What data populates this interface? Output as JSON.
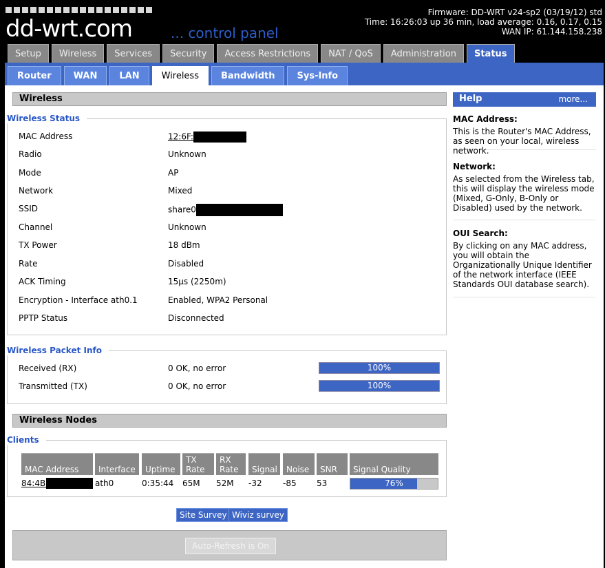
{
  "header": {
    "logo": "dd-wrt.com",
    "subtitle": "... control panel",
    "firmware": "Firmware: DD-WRT v24-sp2 (03/19/12) std",
    "time": "Time: 16:26:03 up 36 min, load average: 0.16, 0.17, 0.15",
    "wan_ip": "WAN IP: 61.144.158.238"
  },
  "main_tabs": [
    "Setup",
    "Wireless",
    "Services",
    "Security",
    "Access Restrictions",
    "NAT / QoS",
    "Administration",
    "Status"
  ],
  "sub_tabs": [
    "Router",
    "WAN",
    "LAN",
    "Wireless",
    "Bandwidth",
    "Sys-Info"
  ],
  "section_title": "Wireless",
  "wireless_status": {
    "legend": "Wireless Status",
    "rows": [
      {
        "label": "MAC Address",
        "value": "12:6F:"
      },
      {
        "label": "Radio",
        "value": "Unknown"
      },
      {
        "label": "Mode",
        "value": "AP"
      },
      {
        "label": "Network",
        "value": "Mixed"
      },
      {
        "label": "SSID",
        "value": "share0"
      },
      {
        "label": "Channel",
        "value": "Unknown"
      },
      {
        "label": "TX Power",
        "value": "18 dBm"
      },
      {
        "label": "Rate",
        "value": "Disabled"
      },
      {
        "label": "ACK Timing",
        "value": "15µs (2250m)"
      },
      {
        "label": "Encryption - Interface ath0.1",
        "value": "Enabled, WPA2 Personal"
      },
      {
        "label": "PPTP Status",
        "value": "Disconnected"
      }
    ]
  },
  "packet_info": {
    "legend": "Wireless Packet Info",
    "rows": [
      {
        "label": "Received (RX)",
        "value": "0 OK, no error",
        "bar": "100%"
      },
      {
        "label": "Transmitted (TX)",
        "value": "0 OK, no error",
        "bar": "100%"
      }
    ]
  },
  "nodes_title": "Wireless Nodes",
  "clients": {
    "legend": "Clients",
    "headers": [
      "MAC Address",
      "Interface",
      "Uptime",
      "TX Rate",
      "RX Rate",
      "Signal",
      "Noise",
      "SNR",
      "Signal Quality"
    ],
    "row": {
      "mac": "84:4B:",
      "interface": "ath0",
      "uptime": "0:35:44",
      "tx": "65M",
      "rx": "52M",
      "signal": "-32",
      "noise": "-85",
      "snr": "53",
      "quality": "76%",
      "quality_value": 0.76
    }
  },
  "buttons": {
    "site_survey": "Site Survey",
    "wiviz": "Wiviz survey",
    "autorefresh": "Auto-Refresh is On"
  },
  "help": {
    "title": "Help",
    "more": "more...",
    "sections": [
      {
        "title": "MAC Address:",
        "text": "This is the Router's MAC Address, as seen on your local, wireless network."
      },
      {
        "title": "Network:",
        "text": "As selected from the Wireless tab, this will display the wireless mode (Mixed, G-Only, B-Only or Disabled) used by the network."
      },
      {
        "title": "OUI Search:",
        "text": "By clicking on any MAC address, you will obtain the Organizationally Unique Identifier of the network interface (IEEE Standards OUI database search)."
      }
    ]
  },
  "colors": {
    "accent": "#3d66c4",
    "legend": "#2857c6",
    "header_bg": "#000000"
  }
}
